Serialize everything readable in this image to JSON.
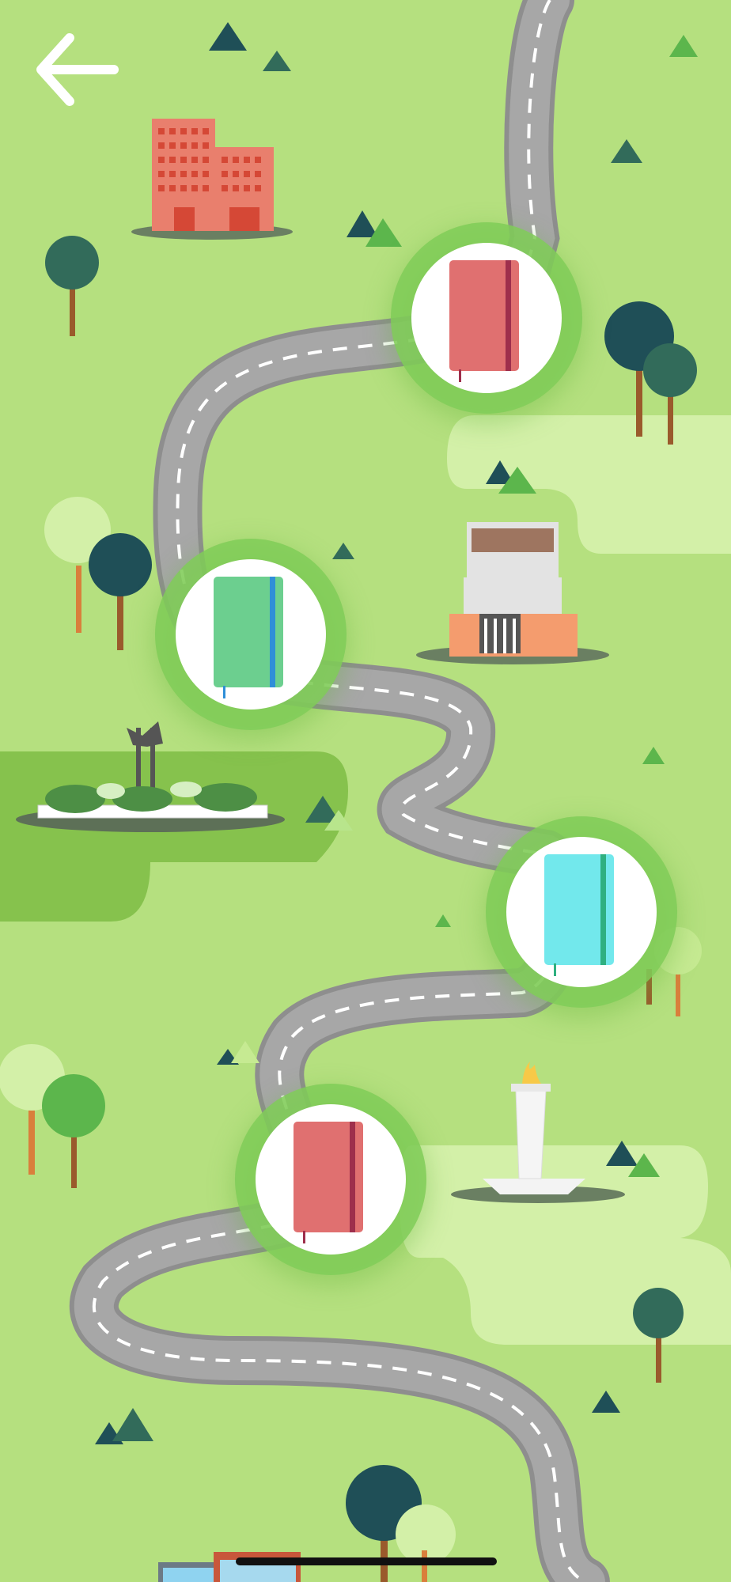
{
  "screen": {
    "name": "learning-path-map"
  },
  "navigation": {
    "back_icon": "arrow-left-icon"
  },
  "colors": {
    "background": "#b5e07f",
    "road": "#a7a7a7",
    "road_edge": "#8e8e8e",
    "lane_marking": "#ffffff",
    "node_glow": "#80cd58",
    "light_patch": "#d3f0a8",
    "dark_patch": "#86c24d"
  },
  "path_nodes": [
    {
      "id": "stage-1",
      "icon": "notebook-icon",
      "cover_color": "#e07070",
      "strap_color": "#9e2f4c"
    },
    {
      "id": "stage-2",
      "icon": "notebook-icon",
      "cover_color": "#6ccf8f",
      "strap_color": "#2f8fd8"
    },
    {
      "id": "stage-3",
      "icon": "notebook-icon",
      "cover_color": "#72e8ec",
      "strap_color": "#2fb080"
    },
    {
      "id": "stage-4",
      "icon": "notebook-icon",
      "cover_color": "#e07070",
      "strap_color": "#9e2f4c"
    }
  ],
  "landmarks": [
    {
      "name": "office-building-icon"
    },
    {
      "name": "museum-building-icon"
    },
    {
      "name": "statue-park-icon"
    },
    {
      "name": "monument-tower-icon"
    },
    {
      "name": "low-building-icon"
    }
  ]
}
